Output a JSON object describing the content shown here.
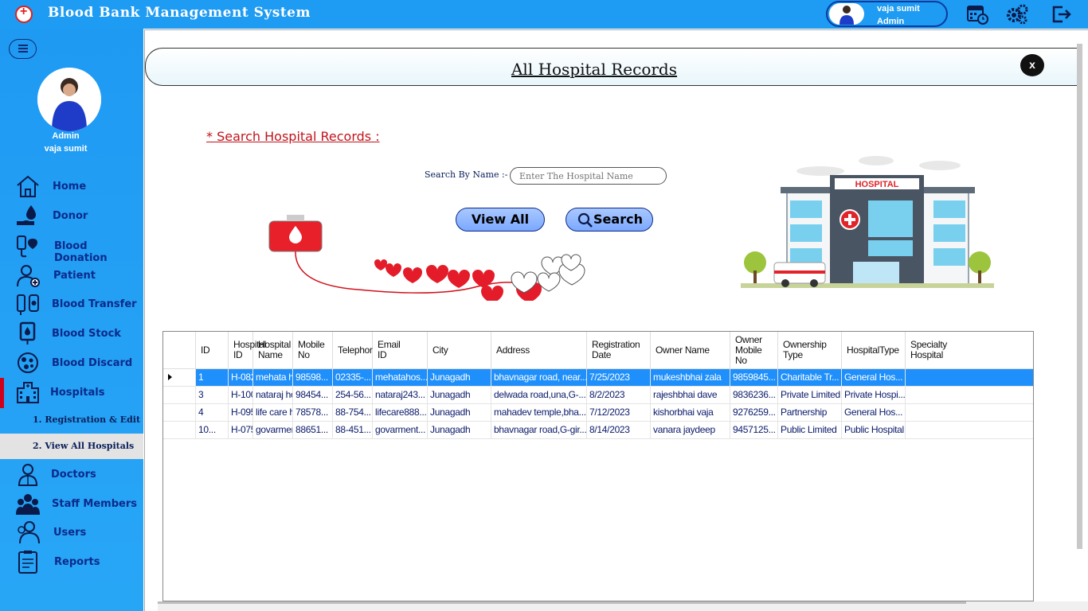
{
  "app": {
    "title": "Blood Bank Management System",
    "user_name": "vaja sumit",
    "user_role": "Admin"
  },
  "header_icons": [
    "calendar-clock-icon",
    "settings-gears-icon",
    "logout-icon"
  ],
  "sidebar": {
    "role": "Admin",
    "name": "vaja sumit",
    "items": [
      {
        "label": "Home",
        "icon": "home-icon"
      },
      {
        "label": "Donor",
        "icon": "donor-icon"
      },
      {
        "label": "Blood Donation",
        "icon": "blood-donation-icon"
      },
      {
        "label": "Patient",
        "icon": "patient-icon"
      },
      {
        "label": "Blood Transfer",
        "icon": "blood-transfer-icon"
      },
      {
        "label": "Blood Stock",
        "icon": "blood-stock-icon"
      },
      {
        "label": "Blood Discard",
        "icon": "blood-discard-icon"
      },
      {
        "label": "Hospitals",
        "icon": "hospital-icon"
      },
      {
        "label": "Doctors",
        "icon": "doctor-icon"
      },
      {
        "label": "Staff Members",
        "icon": "staff-icon"
      },
      {
        "label": "Users",
        "icon": "users-icon"
      },
      {
        "label": "Reports",
        "icon": "reports-icon"
      }
    ],
    "subitems": [
      {
        "label": "1.  Registration & Edit"
      },
      {
        "label": "2.  View All Hospitals"
      }
    ]
  },
  "page": {
    "title": "All Hospital Records",
    "close_label": "x",
    "search_heading": "* Search Hospital  Records  :",
    "search_label": "Search By Name  :-",
    "search_placeholder": "Enter The Hospital Name",
    "view_all_label": "View  All",
    "search_label_btn": "Search",
    "hospital_sign": "HOSPITAL"
  },
  "table": {
    "columns": [
      "ID",
      "Hospital\nID",
      "Hospital\nName",
      "Mobile\nNo",
      "Telephor",
      "Email\nID",
      "City",
      "Address",
      "Registration\nDate",
      "Owner Name",
      "Owner\nMobile\nNo",
      "Ownership\nType",
      "HospitalType",
      "Specialty\nHospital"
    ],
    "rows": [
      [
        "1",
        "H-082...",
        "mehata hospital",
        "98598...",
        "02335-...",
        "mehatahos...",
        "Junagadh",
        "bhavnagar road, near...",
        "7/25/2023",
        "mukeshbhai zala",
        "9859845...",
        "Charitable Tr...",
        "General Hos...",
        ""
      ],
      [
        "3",
        "H-100...",
        "nataraj hospital",
        "98454...",
        "254-56...",
        "nataraj243...",
        "Junagadh",
        "delwada road,una,G-...",
        "8/2/2023",
        "rajeshbhai dave",
        "9836236...",
        "Private Limited",
        "Private Hospi...",
        ""
      ],
      [
        "4",
        "H-095...",
        "life care hospital",
        "78578...",
        "88-754...",
        "lifecare888...",
        "Junagadh",
        "mahadev temple,bha...",
        "7/12/2023",
        "kishorbhai vaja",
        "9276259...",
        "Partnership",
        "General Hos...",
        ""
      ],
      [
        "10...",
        "H-075...",
        "govarment hospital",
        "88651...",
        "88-451...",
        "govarment...",
        "Junagadh",
        "bhavnagar road,G-gir...",
        "8/14/2023",
        "vanara jaydeep",
        "9457125...",
        "Public Limited",
        "Public Hospital",
        ""
      ]
    ],
    "selected_row": 0
  },
  "colors": {
    "topbar": "#1e9bf2",
    "sidebar": "#1f9af3",
    "accent_red": "#c0141c",
    "selection": "#1e8ffb"
  }
}
